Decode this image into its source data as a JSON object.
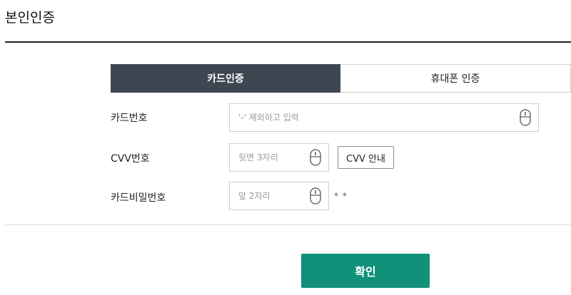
{
  "page": {
    "title": "본인인증"
  },
  "tabs": [
    {
      "label": "카드인증",
      "active": true
    },
    {
      "label": "휴대폰 인증",
      "active": false
    }
  ],
  "form": {
    "card_number": {
      "label": "카드번호",
      "placeholder": "'-' 제외하고 입력",
      "value": "",
      "icon": "mouse-icon"
    },
    "cvv": {
      "label": "CVV번호",
      "placeholder": "뒷면 3자리",
      "value": "",
      "icon": "mouse-icon",
      "guide_button": "CVV 안내"
    },
    "card_password": {
      "label": "카드비밀번호",
      "placeholder": "앞 2자리",
      "value": "",
      "icon": "mouse-icon",
      "mask_suffix": "* *"
    }
  },
  "actions": {
    "confirm_label": "확인"
  },
  "colors": {
    "tab_active_bg": "#3e4652",
    "confirm_bg": "#11907a"
  }
}
